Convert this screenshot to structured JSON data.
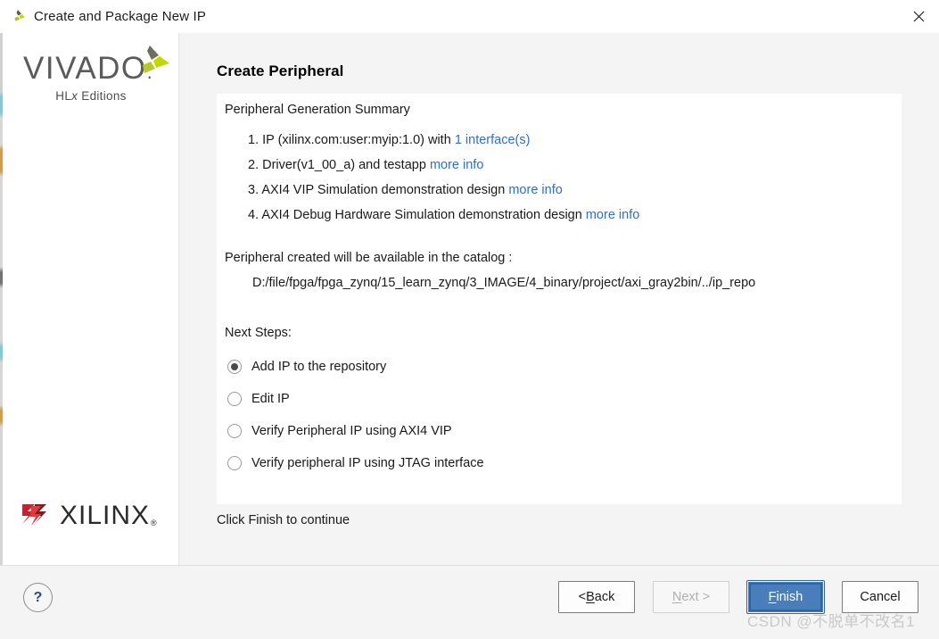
{
  "window": {
    "title": "Create and Package New IP",
    "close_label": "✕",
    "icon_name": "vivado-app-icon"
  },
  "sidebar": {
    "brand_name": "VIVADO",
    "brand_dot": ".",
    "brand_subtitle_pre": "HL",
    "brand_subtitle_italic": "x",
    "brand_subtitle_post": " Editions",
    "vendor_name": "XILINX",
    "vendor_reg": "®"
  },
  "main": {
    "page_title": "Create Peripheral",
    "summary_title": "Peripheral Generation Summary",
    "summary_items": [
      {
        "num": "1.",
        "text": "IP (xilinx.com:user:myip:1.0) with ",
        "link": "1 interface(s)",
        "text_after": ""
      },
      {
        "num": "2.",
        "text": "Driver(v1_00_a) and testapp ",
        "link": "more info",
        "text_after": ""
      },
      {
        "num": "3.",
        "text": "AXI4 VIP Simulation demonstration design ",
        "link": "more info",
        "text_after": ""
      },
      {
        "num": "4.",
        "text": "AXI4 Debug Hardware Simulation demonstration design ",
        "link": "more info",
        "text_after": ""
      }
    ],
    "catalog_label": "Peripheral created will be available in the catalog :",
    "catalog_path": "D:/file/fpga/fpga_zynq/15_learn_zynq/3_IMAGE/4_binary/project/axi_gray2bin/../ip_repo",
    "next_steps_label": "Next Steps:",
    "radio_options": [
      {
        "label": "Add IP to the repository",
        "selected": true
      },
      {
        "label": "Edit IP",
        "selected": false
      },
      {
        "label": "Verify Peripheral IP using AXI4 VIP",
        "selected": false
      },
      {
        "label": "Verify peripheral IP using JTAG interface",
        "selected": false
      }
    ],
    "hint_text": "Click Finish to continue"
  },
  "footer": {
    "help_label": "?",
    "buttons": [
      {
        "name": "back",
        "pre": "< ",
        "accel": "B",
        "post": "ack",
        "state": "enabled"
      },
      {
        "name": "next",
        "pre": "",
        "accel": "N",
        "post": "ext >",
        "state": "disabled"
      },
      {
        "name": "finish",
        "pre": "",
        "accel": "F",
        "post": "inish",
        "state": "primary"
      },
      {
        "name": "cancel",
        "pre": "",
        "accel": "",
        "post": "Cancel",
        "state": "enabled"
      }
    ]
  },
  "watermark": {
    "text": "CSDN @不脱单不改名1"
  },
  "colors": {
    "link": "#2d6fd0",
    "primary_button": "#4a7ebb",
    "primary_button_border": "#2f63ab",
    "xilinx_red": "#c8202e",
    "vivado_green": "#c3d600",
    "panel_bg": "#ffffff",
    "dialog_bg": "#f4f4f4"
  }
}
